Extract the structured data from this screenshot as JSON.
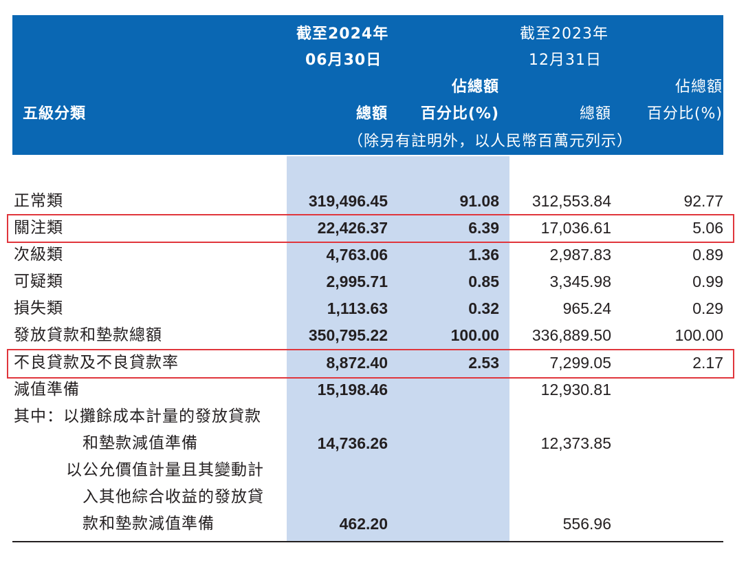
{
  "header": {
    "col2024_line1": "截至2024年",
    "col2024_line2": "06月30日",
    "col2023_line1": "截至2023年",
    "col2023_line2": "12月31日",
    "pct_top_2024": "佔總額",
    "pct_top_2023": "佔總額",
    "category_label": "五級分類",
    "total_2024": "總額",
    "pct_2024": "百分比(%)",
    "total_2023": "總額",
    "pct_2023": "百分比(%)",
    "unit_note": "（除另有註明外，以人民幣百萬元列示）"
  },
  "rows": [
    {
      "label": "正常類",
      "total_2024": "319,496.45",
      "pct_2024": "91.08",
      "total_2023": "312,553.84",
      "pct_2023": "92.77"
    },
    {
      "label": "關注類",
      "total_2024": "22,426.37",
      "pct_2024": "6.39",
      "total_2023": "17,036.61",
      "pct_2023": "5.06"
    },
    {
      "label": "次級類",
      "total_2024": "4,763.06",
      "pct_2024": "1.36",
      "total_2023": "2,987.83",
      "pct_2023": "0.89"
    },
    {
      "label": "可疑類",
      "total_2024": "2,995.71",
      "pct_2024": "0.85",
      "total_2023": "3,345.98",
      "pct_2023": "0.99"
    },
    {
      "label": "損失類",
      "total_2024": "1,113.63",
      "pct_2024": "0.32",
      "total_2023": "965.24",
      "pct_2023": "0.29"
    },
    {
      "label": "發放貸款和墊款總額",
      "total_2024": "350,795.22",
      "pct_2024": "100.00",
      "total_2023": "336,889.50",
      "pct_2023": "100.00"
    },
    {
      "label": "不良貸款及不良貸款率",
      "total_2024": "8,872.40",
      "pct_2024": "2.53",
      "total_2023": "7,299.05",
      "pct_2023": "2.17"
    },
    {
      "label": "減值準備",
      "total_2024": "15,198.46",
      "pct_2024": "",
      "total_2023": "12,930.81",
      "pct_2023": ""
    },
    {
      "label": "其中：以攤餘成本計量的發放貸款",
      "total_2024": "",
      "pct_2024": "",
      "total_2023": "",
      "pct_2023": ""
    },
    {
      "label": "和墊款減值準備",
      "total_2024": "14,736.26",
      "pct_2024": "",
      "total_2023": "12,373.85",
      "pct_2023": ""
    },
    {
      "label": "以公允價值計量且其變動計",
      "total_2024": "",
      "pct_2024": "",
      "total_2023": "",
      "pct_2023": ""
    },
    {
      "label": "入其他綜合收益的發放貸",
      "total_2024": "",
      "pct_2024": "",
      "total_2023": "",
      "pct_2023": ""
    },
    {
      "label": "款和墊款減值準備",
      "total_2024": "462.20",
      "pct_2024": "",
      "total_2023": "556.96",
      "pct_2023": ""
    }
  ],
  "colors": {
    "header_bg": "#0a67b3",
    "shade": "#c9d9ef",
    "highlight": "#e0353b"
  }
}
